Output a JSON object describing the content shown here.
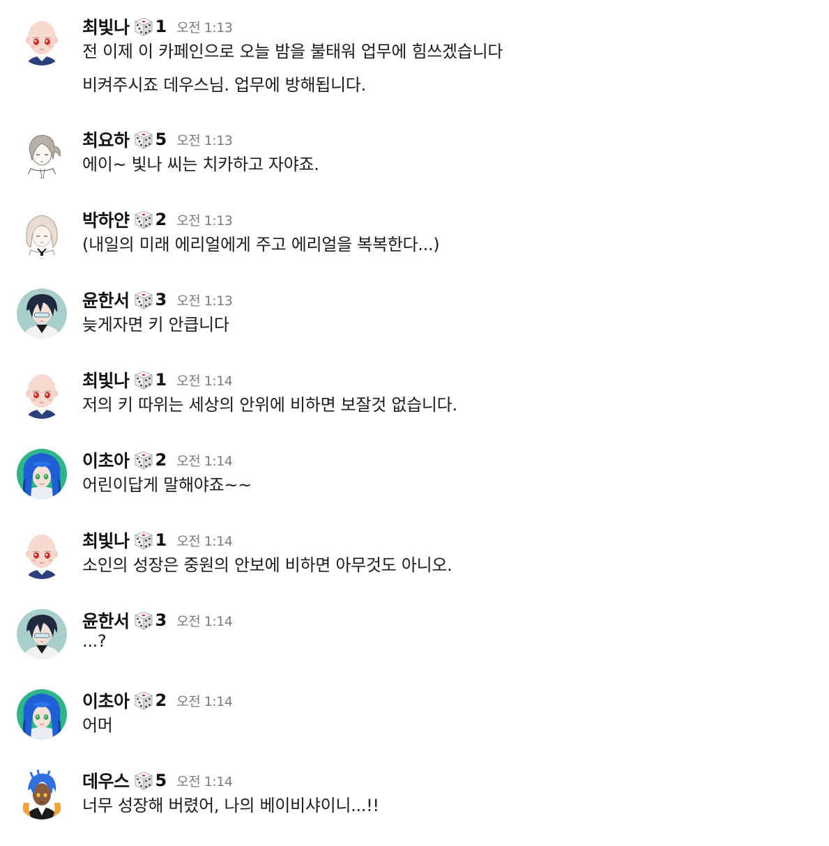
{
  "colors": {
    "name_text": "#111111",
    "message_text": "#1b1b1b",
    "timestamp_text": "#7a7a7a",
    "background": "#ffffff"
  },
  "messages": [
    {
      "avatar": "bald-red-eyed-avatar",
      "name": "최빛나",
      "dice_icon": "die-icon",
      "roll": "1",
      "time": "오전 1:13",
      "lines": [
        "전 이제 이 카페인으로 오늘 밤을 불태워 업무에 힘쓰겠습니다",
        "비켜주시죠 데우스님. 업무에 방해됩니다."
      ]
    },
    {
      "avatar": "grey-haired-sketch-avatar",
      "name": "최요하",
      "dice_icon": "die-icon",
      "roll": "5",
      "time": "오전 1:13",
      "lines": [
        "에이~ 빛나 씨는 치카하고 자야죠."
      ]
    },
    {
      "avatar": "light-haired-sketch-avatar",
      "name": "박하얀",
      "dice_icon": "die-icon",
      "roll": "2",
      "time": "오전 1:13",
      "lines": [
        "(내일의 미래 에리얼에게 주고 에리얼을 복복한다...)"
      ]
    },
    {
      "avatar": "dark-haired-avatar",
      "name": "윤한서",
      "dice_icon": "die-icon",
      "roll": "3",
      "time": "오전 1:13",
      "lines": [
        "늦게자면 키 안큽니다"
      ]
    },
    {
      "avatar": "bald-red-eyed-avatar",
      "name": "최빛나",
      "dice_icon": "die-icon",
      "roll": "1",
      "time": "오전 1:14",
      "lines": [
        "저의 키 따위는 세상의 안위에 비하면 보잘것 없습니다."
      ]
    },
    {
      "avatar": "blue-haired-avatar",
      "name": "이초아",
      "dice_icon": "die-icon",
      "roll": "2",
      "time": "오전 1:14",
      "lines": [
        "어린이답게 말해야죠~~"
      ]
    },
    {
      "avatar": "bald-red-eyed-avatar",
      "name": "최빛나",
      "dice_icon": "die-icon",
      "roll": "1",
      "time": "오전 1:14",
      "lines": [
        "소인의 성장은 중원의 안보에 비하면 아무것도 아니오."
      ]
    },
    {
      "avatar": "dark-haired-avatar",
      "name": "윤한서",
      "dice_icon": "die-icon",
      "roll": "3",
      "time": "오전 1:14",
      "lines": [
        "...?"
      ]
    },
    {
      "avatar": "blue-haired-avatar",
      "name": "이초아",
      "dice_icon": "die-icon",
      "roll": "2",
      "time": "오전 1:14",
      "lines": [
        "어머"
      ]
    },
    {
      "avatar": "blue-haired-tan-avatar",
      "name": "데우스",
      "dice_icon": "die-icon",
      "roll": "5",
      "time": "오전 1:14",
      "lines": [
        "너무 성장해 버렸어, 나의 베이비샤이니...!!"
      ]
    }
  ]
}
